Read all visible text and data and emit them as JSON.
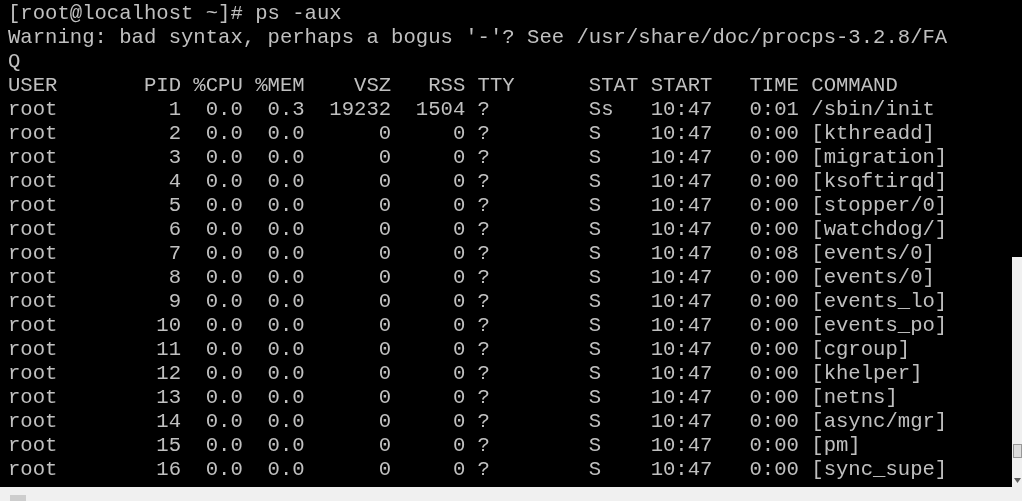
{
  "terminal": {
    "lines": [
      "[root@localhost ~]# ps -aux",
      "Warning: bad syntax, perhaps a bogus '-'? See /usr/share/doc/procps-3.2.8/FA",
      "Q",
      "USER       PID %CPU %MEM    VSZ   RSS TTY      STAT START   TIME COMMAND",
      "root         1  0.0  0.3  19232  1504 ?        Ss   10:47   0:01 /sbin/init",
      "root         2  0.0  0.0      0     0 ?        S    10:47   0:00 [kthreadd]",
      "root         3  0.0  0.0      0     0 ?        S    10:47   0:00 [migration]",
      "root         4  0.0  0.0      0     0 ?        S    10:47   0:00 [ksoftirqd]",
      "root         5  0.0  0.0      0     0 ?        S    10:47   0:00 [stopper/0]",
      "root         6  0.0  0.0      0     0 ?        S    10:47   0:00 [watchdog/]",
      "root         7  0.0  0.0      0     0 ?        S    10:47   0:08 [events/0]",
      "root         8  0.0  0.0      0     0 ?        S    10:47   0:00 [events/0]",
      "root         9  0.0  0.0      0     0 ?        S    10:47   0:00 [events_lo]",
      "root        10  0.0  0.0      0     0 ?        S    10:47   0:00 [events_po]",
      "root        11  0.0  0.0      0     0 ?        S    10:47   0:00 [cgroup]",
      "root        12  0.0  0.0      0     0 ?        S    10:47   0:00 [khelper]",
      "root        13  0.0  0.0      0     0 ?        S    10:47   0:00 [netns]",
      "root        14  0.0  0.0      0     0 ?        S    10:47   0:00 [async/mgr]",
      "root        15  0.0  0.0      0     0 ?        S    10:47   0:00 [pm]",
      "root        16  0.0  0.0      0     0 ?        S    10:47   0:00 [sync_supe]"
    ]
  }
}
